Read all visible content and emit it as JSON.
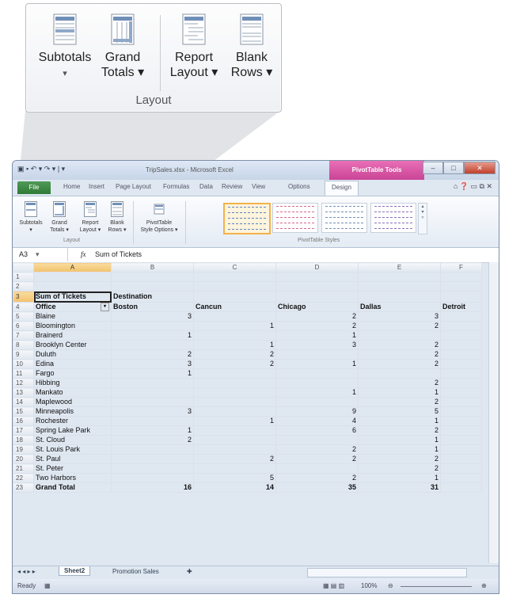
{
  "callout": {
    "buttons": [
      {
        "line1": "Subtotals",
        "line2": "▾",
        "icon": "subtotals-icon"
      },
      {
        "line1": "Grand",
        "line2": "Totals ▾",
        "icon": "grand-totals-icon"
      },
      {
        "line1": "Report",
        "line2": "Layout ▾",
        "icon": "report-layout-icon"
      },
      {
        "line1": "Blank",
        "line2": "Rows ▾",
        "icon": "blank-rows-icon"
      }
    ],
    "group_label": "Layout"
  },
  "window": {
    "title": "TripSales.xlsx - Microsoft Excel",
    "context_tab_group": "PivotTable Tools",
    "tabs": [
      "File",
      "Home",
      "Insert",
      "Page Layout",
      "Formulas",
      "Data",
      "Review",
      "View",
      "Options",
      "Design"
    ],
    "active_tab": "Design"
  },
  "ribbon": {
    "layout_buttons": [
      {
        "line1": "Subtotals",
        "line2": "▾"
      },
      {
        "line1": "Grand",
        "line2": "Totals ▾"
      },
      {
        "line1": "Report",
        "line2": "Layout ▾"
      },
      {
        "line1": "Blank",
        "line2": "Rows ▾"
      }
    ],
    "layout_group": "Layout",
    "style_options_line1": "PivotTable",
    "style_options_line2": "Style Options ▾",
    "styles_group": "PivotTable Styles"
  },
  "formula_bar": {
    "cell": "A3",
    "fx": "fx",
    "value": "Sum of Tickets"
  },
  "sheet": {
    "columns": [
      "A",
      "B",
      "C",
      "D",
      "E",
      "F"
    ],
    "header_row": {
      "r": "3",
      "a": "Sum of Tickets",
      "b": "Destination"
    },
    "label_row": {
      "r": "4",
      "a": "Office",
      "b": "Boston",
      "c": "Cancun",
      "d": "Chicago",
      "e": "Dallas",
      "f": "Detroit"
    },
    "rows": [
      {
        "r": "5",
        "office": "Blaine",
        "boston": "3",
        "cancun": "",
        "chicago": "2",
        "dallas": "3"
      },
      {
        "r": "6",
        "office": "Bloomington",
        "boston": "",
        "cancun": "1",
        "chicago": "2",
        "dallas": "2"
      },
      {
        "r": "7",
        "office": "Brainerd",
        "boston": "1",
        "cancun": "",
        "chicago": "1",
        "dallas": ""
      },
      {
        "r": "8",
        "office": "Brooklyn Center",
        "boston": "",
        "cancun": "1",
        "chicago": "3",
        "dallas": "2"
      },
      {
        "r": "9",
        "office": "Duluth",
        "boston": "2",
        "cancun": "2",
        "chicago": "",
        "dallas": "2"
      },
      {
        "r": "10",
        "office": "Edina",
        "boston": "3",
        "cancun": "2",
        "chicago": "1",
        "dallas": "2"
      },
      {
        "r": "11",
        "office": "Fargo",
        "boston": "1",
        "cancun": "",
        "chicago": "",
        "dallas": ""
      },
      {
        "r": "12",
        "office": "Hibbing",
        "boston": "",
        "cancun": "",
        "chicago": "",
        "dallas": "2"
      },
      {
        "r": "13",
        "office": "Mankato",
        "boston": "",
        "cancun": "",
        "chicago": "1",
        "dallas": "1"
      },
      {
        "r": "14",
        "office": "Maplewood",
        "boston": "",
        "cancun": "",
        "chicago": "",
        "dallas": "2"
      },
      {
        "r": "15",
        "office": "Minneapolis",
        "boston": "3",
        "cancun": "",
        "chicago": "9",
        "dallas": "5"
      },
      {
        "r": "16",
        "office": "Rochester",
        "boston": "",
        "cancun": "1",
        "chicago": "4",
        "dallas": "1"
      },
      {
        "r": "17",
        "office": "Spring Lake Park",
        "boston": "1",
        "cancun": "",
        "chicago": "6",
        "dallas": "2"
      },
      {
        "r": "18",
        "office": "St. Cloud",
        "boston": "2",
        "cancun": "",
        "chicago": "",
        "dallas": "1"
      },
      {
        "r": "19",
        "office": "St. Louis Park",
        "boston": "",
        "cancun": "",
        "chicago": "2",
        "dallas": "1"
      },
      {
        "r": "20",
        "office": "St. Paul",
        "boston": "",
        "cancun": "2",
        "chicago": "2",
        "dallas": "2"
      },
      {
        "r": "21",
        "office": "St. Peter",
        "boston": "",
        "cancun": "",
        "chicago": "",
        "dallas": "2"
      },
      {
        "r": "22",
        "office": "Two Harbors",
        "boston": "",
        "cancun": "5",
        "chicago": "2",
        "dallas": "1"
      }
    ],
    "total_row": {
      "r": "23",
      "office": "Grand Total",
      "boston": "16",
      "cancun": "14",
      "chicago": "35",
      "dallas": "31"
    }
  },
  "sheet_tabs": {
    "nav": "◂ ◂ ▸ ▸",
    "active": "Sheet2",
    "other": "Promotion Sales"
  },
  "status_bar": {
    "ready": "Ready",
    "zoom": "100%"
  }
}
